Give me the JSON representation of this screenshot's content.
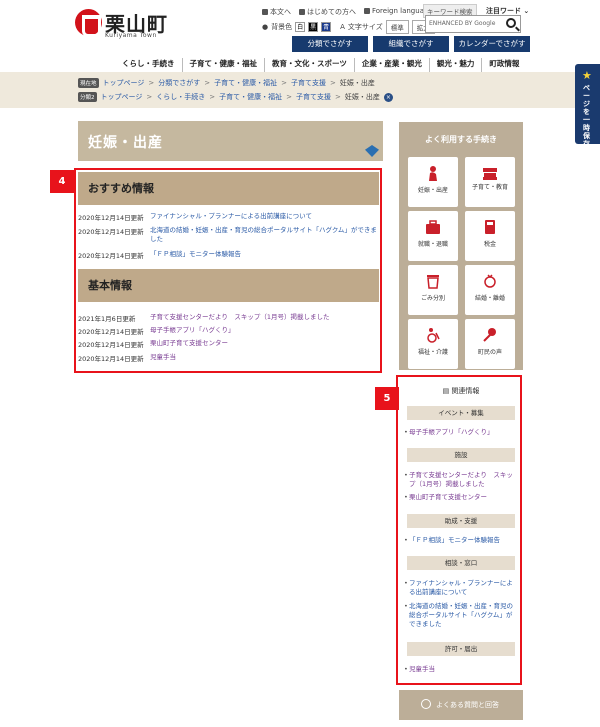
{
  "header": {
    "logo_text": "栗山町",
    "logo_sub": "Kuriyama Town",
    "toplinks": [
      "本文へ",
      "はじめての方へ",
      "Foreign language"
    ],
    "keyword_search": "キーワード検索",
    "popular_words": "注目ワード",
    "bg_color_label": "背景色",
    "swatches": [
      "白",
      "黒",
      "青"
    ],
    "font_size_label": "文字サイズ",
    "font_standard": "標準",
    "font_large": "拡大",
    "search_placeholder": "ENHANCED BY Google"
  },
  "guide_buttons": [
    "分類でさがす",
    "組織でさがす",
    "カレンダーでさがす"
  ],
  "global_nav": [
    "くらし・手続き",
    "子育て・健康・福祉",
    "教育・文化・スポーツ",
    "企業・産業・観光",
    "観光・魅力",
    "町政情報"
  ],
  "breadcrumbs": {
    "current": {
      "tag": "現在地",
      "items": [
        "トップページ",
        "分類でさがす",
        "子育て・健康・福祉",
        "子育て支援",
        "妊娠・出産"
      ]
    },
    "alternate": {
      "tag": "分類2",
      "items": [
        "トップページ",
        "くらし・手続き",
        "子育て・健康・福祉",
        "子育て支援",
        "妊娠・出産"
      ]
    }
  },
  "page_title": "妊娠・出産",
  "recommended": {
    "heading": "おすすめ情報",
    "badge": "4",
    "items": [
      {
        "date": "2020年12月14日更新",
        "title": "ファイナンシャル・プランナーによる出前講座について"
      },
      {
        "date": "2020年12月14日更新",
        "title": "北海道の結婚・妊娠・出産・育児の総合ポータルサイト「ハグクム」ができました"
      },
      {
        "date": "2020年12月14日更新",
        "title": "「ＦＰ相談」モニター体験報告"
      }
    ]
  },
  "basic": {
    "heading": "基本情報",
    "items": [
      {
        "date": "2021年1月6日更新",
        "title": "子育て支援センターだより　スキップ（1月号）掲載しました"
      },
      {
        "date": "2020年12月14日更新",
        "title": "母子手帳アプリ「ハグくり」"
      },
      {
        "date": "2020年12月14日更新",
        "title": "栗山町子育て支援センター"
      },
      {
        "date": "2020年12月14日更新",
        "title": "児童手当"
      }
    ]
  },
  "frequent": {
    "title": "よく利用する手続き",
    "tiles": [
      "妊娠・出産",
      "子育て・教育",
      "就職・退職",
      "税金",
      "ごみ分別",
      "結婚・離婚",
      "福祉・介護",
      "町民の声"
    ]
  },
  "related": {
    "heading": "関連情報",
    "badge": "5",
    "groups": [
      {
        "category": "イベント・募集",
        "links": [
          "母子手帳アプリ「ハグくり」"
        ]
      },
      {
        "category": "施設",
        "links": [
          "子育て支援センターだより　スキップ（1月号）掲載しました",
          "栗山町子育て支援センター"
        ]
      },
      {
        "category": "助成・支援",
        "links": [
          "「ＦＰ相談」モニター体験報告"
        ]
      },
      {
        "category": "相談・窓口",
        "links": [
          "ファイナンシャル・プランナーによる出前講座について",
          "北海道の結婚・妊娠・出産・育児の総合ポータルサイト「ハグクム」ができました"
        ]
      },
      {
        "category": "許可・届出",
        "links": [
          "児童手当"
        ]
      }
    ]
  },
  "faq_label": "よくある質問と回答",
  "ichiji": "ページを一時保存",
  "colors": {
    "accent_red": "#e8131b",
    "navy": "#173a6e",
    "tan": "#bfa98a"
  }
}
